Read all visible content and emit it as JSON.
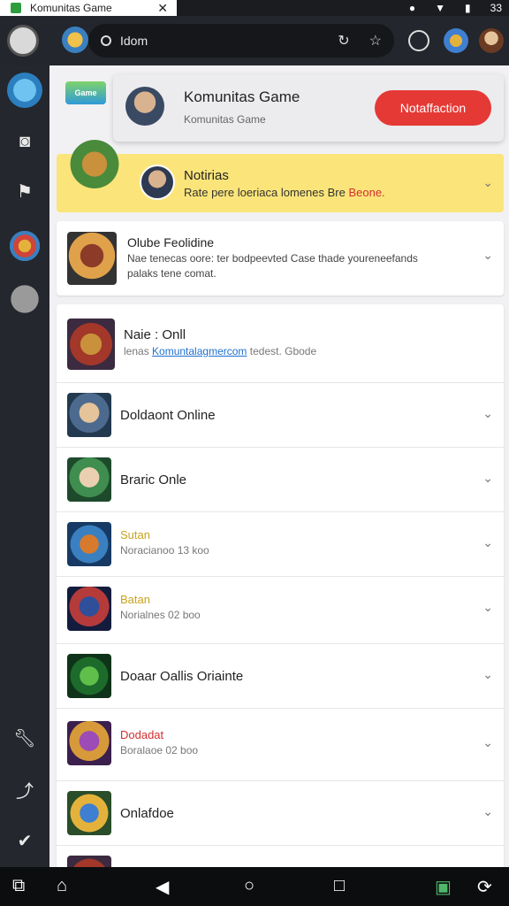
{
  "tab": {
    "title": "Komunitas Game",
    "close": "✕"
  },
  "status": {
    "time": "33"
  },
  "toolbar": {
    "url": "Idom"
  },
  "popover": {
    "title": "Komunitas Game",
    "subtitle": "Komunitas Game",
    "button": "Notaffaction",
    "more": "⋮"
  },
  "banner": {
    "logo": "Game"
  },
  "notification": {
    "title": "Notirias",
    "text_main": "Rate pere loeriaca lomenes Bre",
    "text_red": "Beone."
  },
  "feature": {
    "title": "Olube Feolidine",
    "text": "Nae tenecas oore: ter bodpeevted Case thade youreneefands palaks tene comat."
  },
  "list": {
    "header": {
      "title": "Naie : Onll",
      "prefix": "lenas",
      "link": "Komuntalagmercom",
      "suffix": "tedest. Gbode"
    },
    "items": [
      {
        "name": "Doldaont Online"
      },
      {
        "name": "Braric Onle"
      },
      {
        "name": "Sutan",
        "sub": "Noracianoo 13 koo",
        "color": "#c9a21b"
      },
      {
        "name": "Batan",
        "sub": "Norialnes 02 boo",
        "color": "#c9a21b"
      },
      {
        "name": "Doaar Oallis Oriainte"
      },
      {
        "name": "Dodadat",
        "sub": "Boralaoe 02 boo",
        "color": "#d32f2f"
      },
      {
        "name": "Onlafdoe"
      }
    ]
  },
  "colors": {
    "accent_red": "#e53935",
    "notif_bg": "#fbe57a",
    "rail_bg": "#24272d"
  }
}
